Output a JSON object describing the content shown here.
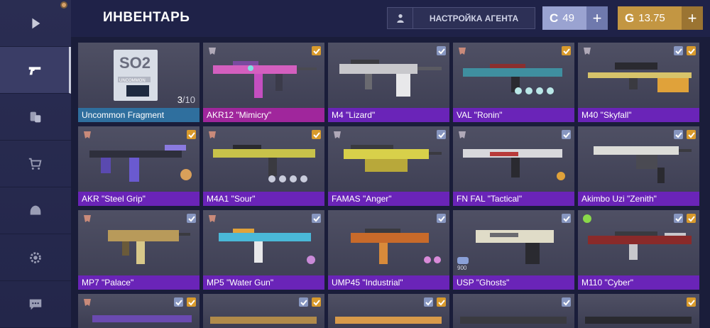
{
  "header": {
    "title": "ИНВЕНТАРЬ",
    "agent_button": "НАСТРОЙКА АГЕНТА",
    "currency_blue": "49",
    "currency_gold": "13.75"
  },
  "sidebar": {
    "items": [
      "play",
      "weapons",
      "cases",
      "shop",
      "clan",
      "settings",
      "chat"
    ]
  },
  "fragment": {
    "tile_code": "SO2",
    "tile_rarity": "UNCOMMON",
    "count": "3",
    "sep_total": "/10"
  },
  "sticker_count": "900",
  "items": [
    "Uncommon Fragment",
    "AKR12 \"Mimicry\"",
    "M4 \"Lizard\"",
    "VAL \"Ronin\"",
    "M40 \"Skyfall\"",
    "AKR \"Steel Grip\"",
    "M4A1 \"Sour\"",
    "FAMAS \"Anger\"",
    "FN FAL \"Tactical\"",
    "Akimbo Uzi \"Zenith\"",
    "MP7 \"Palace\"",
    "MP5 \"Water Gun\"",
    "UMP45 \"Industrial\"",
    "USP \"Ghosts\"",
    "M110 \"Cyber\""
  ],
  "colors": {
    "rare": "#6a24b8",
    "fragment": "#2f6f9e",
    "epic": "#a0269c",
    "gold": "#c39642",
    "silver": "#9aa3d1"
  }
}
